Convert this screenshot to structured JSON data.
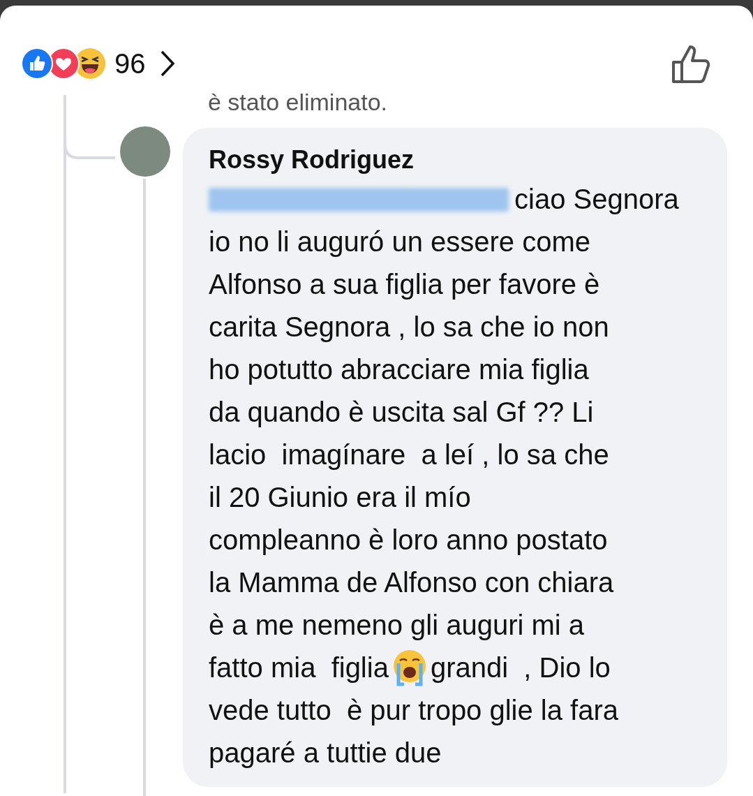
{
  "reactions": {
    "count": "96"
  },
  "deleted_notice": "è stato eliminato.",
  "comment": {
    "author": "Rossy Rodriguez",
    "lines": [
      [
        {
          "kind": "mention"
        },
        {
          "kind": "text",
          "text": "ciao Segnora"
        }
      ],
      [
        {
          "kind": "text",
          "text": "io no li auguró un essere come"
        }
      ],
      [
        {
          "kind": "text",
          "text": "Alfonso a sua figlia per favore è"
        }
      ],
      [
        {
          "kind": "text",
          "text": "carita Segnora , lo sa che io non"
        }
      ],
      [
        {
          "kind": "text",
          "text": "ho potutto abracciare mia figlia"
        }
      ],
      [
        {
          "kind": "text",
          "text": "da quando è uscita sal Gf ?? Li"
        }
      ],
      [
        {
          "kind": "text",
          "text": "lacio  imagínare  a leí , lo sa che"
        }
      ],
      [
        {
          "kind": "text",
          "text": "il 20 Giunio era il mío"
        }
      ],
      [
        {
          "kind": "text",
          "text": "compleanno è loro anno postato"
        }
      ],
      [
        {
          "kind": "text",
          "text": "la Mamma de Alfonso con chiara"
        }
      ],
      [
        {
          "kind": "text",
          "text": "è a me nemeno gli auguri mi a"
        }
      ],
      [
        {
          "kind": "text",
          "text": "fatto mia  figlia"
        },
        {
          "kind": "emoji"
        },
        {
          "kind": "text",
          "text": "grandi  , Dio lo"
        }
      ],
      [
        {
          "kind": "text",
          "text": "vede tutto  è pur tropo glie la fara"
        }
      ],
      [
        {
          "kind": "text",
          "text": "pagaré a tuttie due"
        }
      ]
    ]
  }
}
